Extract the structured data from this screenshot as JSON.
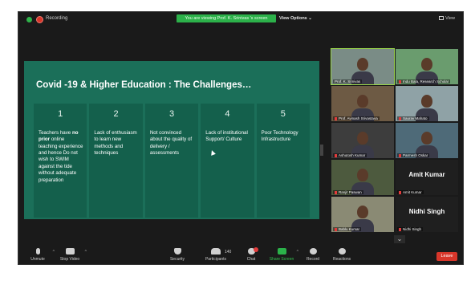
{
  "topbar": {
    "recording_label": "Recording",
    "viewing_banner": "You are viewing Prof. K. Srinivas 's screen",
    "view_options_label": "View Options ⌄",
    "view_label": "View"
  },
  "slide": {
    "title": "Covid -19 & Higher Education : The Challenges…",
    "columns": [
      {
        "num": "1",
        "pre": "Teachers have ",
        "bold": "no prior",
        "post": " online teaching experience and hence Do not wish to SWIM against the tide without adequate preparation"
      },
      {
        "num": "2",
        "pre": "Lack of enthusiasm to learn new methods and techniques",
        "bold": "",
        "post": ""
      },
      {
        "num": "3",
        "pre": "Not convinced about the quality of delivery / assessments",
        "bold": "",
        "post": ""
      },
      {
        "num": "4",
        "pre": "Lack of institutional Support/ Culture",
        "bold": "",
        "post": ""
      },
      {
        "num": "5",
        "pre": "Poor Technology Infrastructure",
        "bold": "",
        "post": ""
      }
    ]
  },
  "participants": [
    {
      "name": "Prof. K. Srinivas",
      "big": "",
      "active": true,
      "bg": "#7a8c86"
    },
    {
      "name": "Indu Bala, Research Scholar",
      "big": "",
      "active": false,
      "bg": "#6a9c6e"
    },
    {
      "name": "Prof. Avinash Srivastava",
      "big": "",
      "active": false,
      "bg": "#6d5a44"
    },
    {
      "name": "Saurav Mahato",
      "big": "",
      "active": false,
      "bg": "#8fa2a6"
    },
    {
      "name": "Ashutosh Kumar",
      "big": "",
      "active": false,
      "bg": "#3d3d3d"
    },
    {
      "name": "Parmesh Oskar",
      "big": "",
      "active": false,
      "bg": "#4e6a78"
    },
    {
      "name": "Ranjit Paswan",
      "big": "",
      "active": false,
      "bg": "#4d5a3e"
    },
    {
      "name": "Amit Kumar",
      "big": "Amit Kumar",
      "active": false,
      "bg": "#1f1f1f"
    },
    {
      "name": "Bablu Kumar",
      "big": "",
      "active": false,
      "bg": "#8a8a74"
    },
    {
      "name": "Nidhi Singh",
      "big": "Nidhi Singh",
      "active": false,
      "bg": "#1f1f1f"
    }
  ],
  "toolbar": {
    "unmute": "Unmute",
    "stop_video": "Stop Video",
    "security": "Security",
    "participants": "Participants",
    "participants_count": "140",
    "chat": "Chat",
    "share_screen": "Share Screen",
    "record": "Record",
    "reactions": "Reactions",
    "leave": "Leave"
  },
  "colors": {
    "slide_bg": "#1b6f59",
    "share_green": "#2cb14a",
    "leave_red": "#d8362a"
  }
}
